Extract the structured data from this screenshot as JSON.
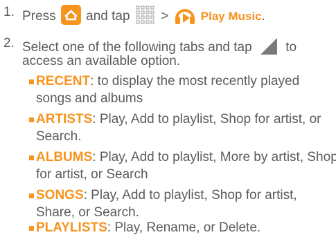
{
  "steps": [
    {
      "number": "1.",
      "text_before_home": "Press",
      "text_after_home": "and tap",
      "separator": ">",
      "app_name": "Play Music",
      "end": "."
    },
    {
      "number": "2.",
      "line1_before_icon": "Select one of the following tabs and tap",
      "line1_after_icon": "to",
      "line2": "access an available option."
    }
  ],
  "options": [
    {
      "label": "RECENT",
      "line1": ": to display the most recently played",
      "line2": "songs and albums"
    },
    {
      "label": "ARTISTS",
      "line1": ": Play, Add to playlist, Shop for artist, or",
      "line2": "Search."
    },
    {
      "label": "ALBUMS",
      "line1": ": Play, Add to playlist, More by artist, Shop",
      "line2": "for artist, or Search"
    },
    {
      "label": "SONGS",
      "line1": ": Play, Add to playlist, Shop for artist,",
      "line2": "Share, or Search."
    },
    {
      "label": "PLAYLISTS",
      "line1": ": Play, Rename, or Delete.",
      "line2": ""
    }
  ],
  "colors": {
    "accent": "#f7941d",
    "text": "#5b5b5b"
  },
  "icons": [
    "home-icon",
    "apps-grid-icon",
    "play-music-icon",
    "menu-icon"
  ]
}
